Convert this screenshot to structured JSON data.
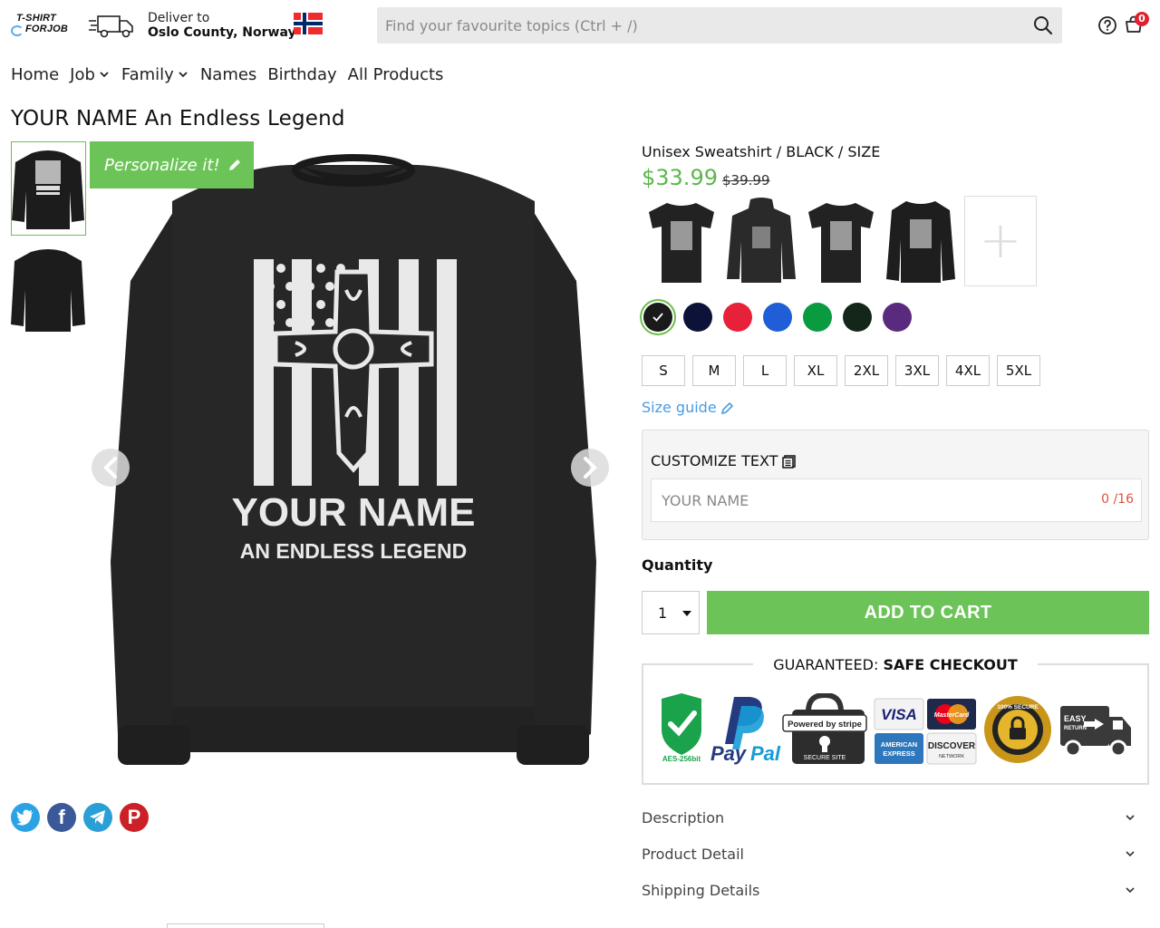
{
  "brand": {
    "logo_line1": "T-SHIRT",
    "logo_line2": "FORJOB"
  },
  "delivery": {
    "label": "Deliver to",
    "location": "Oslo County, Norway"
  },
  "search": {
    "placeholder": "Find your favourite topics (Ctrl + /)"
  },
  "cart": {
    "count": "0"
  },
  "icons": {
    "truck": "delivery-truck-icon",
    "flag": "norway-flag-icon",
    "search": "search-icon",
    "help": "help-icon",
    "cart": "cart-icon",
    "chevron": "chevron-down-icon",
    "pencil": "pencil-icon",
    "document": "document-icon"
  },
  "nav": [
    {
      "label": "Home",
      "dropdown": false
    },
    {
      "label": "Job",
      "dropdown": true
    },
    {
      "label": "Family",
      "dropdown": true
    },
    {
      "label": "Names",
      "dropdown": false
    },
    {
      "label": "Birthday",
      "dropdown": false
    },
    {
      "label": "All Products",
      "dropdown": false
    }
  ],
  "product": {
    "title": "YOUR NAME An Endless Legend",
    "personalize_label": "Personalize it!",
    "print_name": "YOUR NAME",
    "print_tagline": "AN ENDLESS LEGEND",
    "variant": "Unisex Sweatshirt /  BLACK /  SIZE",
    "price": "$33.99",
    "old_price": "$39.99",
    "styles": [
      "T-Shirt",
      "Hoodie",
      "T-Shirt",
      "Sweatshirt"
    ],
    "add_style_label": "+",
    "colors": [
      {
        "name": "Black",
        "hex": "#1a1a1a",
        "selected": true
      },
      {
        "name": "Navy",
        "hex": "#0d1238"
      },
      {
        "name": "Red",
        "hex": "#e8213a"
      },
      {
        "name": "Royal Blue",
        "hex": "#1f5ed6"
      },
      {
        "name": "Kelly Green",
        "hex": "#0a9a3f"
      },
      {
        "name": "Forest Green",
        "hex": "#14261a"
      },
      {
        "name": "Purple",
        "hex": "#5a2a7e"
      }
    ],
    "sizes": [
      "S",
      "M",
      "L",
      "XL",
      "2XL",
      "3XL",
      "4XL",
      "5XL"
    ],
    "size_guide": "Size guide"
  },
  "customize": {
    "title": "CUSTOMIZE TEXT",
    "placeholder": "YOUR NAME",
    "counter": "0 /16"
  },
  "quantity": {
    "label": "Quantity",
    "value": "1"
  },
  "add_to_cart": "ADD TO CART",
  "guarantee": {
    "prefix": "GUARANTEED:",
    "strong": "SAFE CHECKOUT",
    "badges": {
      "aes": "AES-256bit",
      "paypal_1": "Pay",
      "paypal_2": "Pal",
      "stripe_top": "Powered by stripe",
      "stripe_bottom": "SECURE SITE",
      "visa": "VISA",
      "mastercard": "MasterCard",
      "amex_1": "AMERICAN",
      "amex_2": "EXPRESS",
      "discover": "DISCOVER",
      "discover_sub": "NETWORK",
      "secure_seal": "100% SECURE",
      "return_1": "EASY",
      "return_2": "RETURN"
    }
  },
  "accordion": [
    "Description",
    "Product Detail",
    "Shipping Details"
  ],
  "social": [
    "twitter-icon",
    "facebook-icon",
    "telegram-icon",
    "pinterest-icon"
  ],
  "colors_theme": {
    "accent_green": "#6cc358",
    "price_green": "#5cb84a",
    "link_blue": "#4a9be0",
    "badge_red": "#e0202e",
    "counter_red": "#e0533a"
  }
}
